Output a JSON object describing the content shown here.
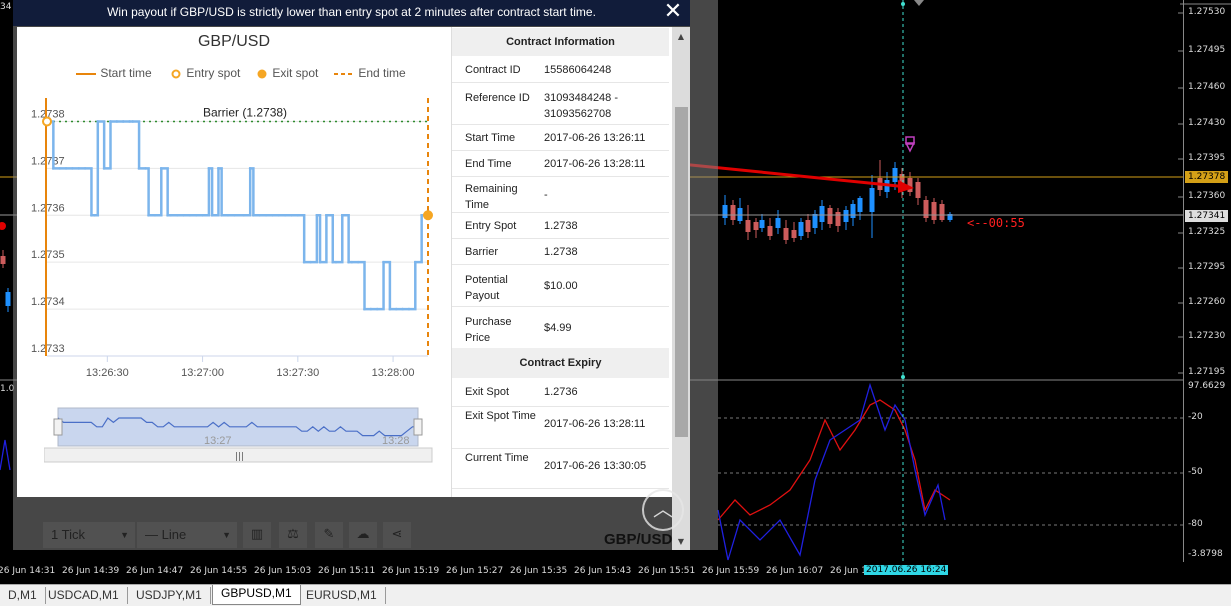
{
  "dialog": {
    "title": "Win payout if GBP/USD is strictly lower than entry spot at 2 minutes after contract start time.",
    "close_label": "✕"
  },
  "mini_chart": {
    "title": "GBP/USD",
    "legend": {
      "start_time": "Start time",
      "entry_spot": "Entry spot",
      "exit_spot": "Exit spot",
      "end_time": "End time"
    },
    "barrier_label": "Barrier (1.2738)",
    "navigator_labels": [
      "13:27",
      "13:28"
    ],
    "colors": {
      "line": "#7cb5ec",
      "start_end": "#e8850c",
      "barrier": "#2e8b2e"
    }
  },
  "chart_data": {
    "type": "line",
    "title": "GBP/USD",
    "xlabel": "",
    "ylabel": "",
    "x_ticks": [
      "13:26:30",
      "13:27:00",
      "13:27:30",
      "13:28:00"
    ],
    "y_ticks": [
      "1.2738",
      "1.2737",
      "1.2736",
      "1.2735",
      "1.2734",
      "1.2733"
    ],
    "ylim": [
      1.2733,
      1.27385
    ],
    "xlim": [
      "13:26:11",
      "13:28:11"
    ],
    "series": [
      {
        "values_x": [
          "13:26:11",
          "13:26:13",
          "13:26:15",
          "13:26:17",
          "13:26:19",
          "13:26:21",
          "13:26:23",
          "13:26:25",
          "13:26:26",
          "13:26:27",
          "13:26:29",
          "13:26:31",
          "13:26:33",
          "13:26:35",
          "13:26:37",
          "13:26:38",
          "13:26:40",
          "13:26:42",
          "13:26:43",
          "13:26:45",
          "13:26:47",
          "13:26:49",
          "13:26:50",
          "13:26:52",
          "13:26:54",
          "13:26:56",
          "13:26:58",
          "13:27:00",
          "13:27:02",
          "13:27:03",
          "13:27:05",
          "13:27:06",
          "13:27:08",
          "13:27:10",
          "13:27:13",
          "13:27:15",
          "13:27:16",
          "13:27:18",
          "13:27:20",
          "13:27:22",
          "13:27:24",
          "13:27:26",
          "13:27:28",
          "13:27:30",
          "13:27:32",
          "13:27:34",
          "13:27:36",
          "13:27:37",
          "13:27:39",
          "13:27:41",
          "13:27:42",
          "13:27:44",
          "13:27:46",
          "13:27:47",
          "13:27:49",
          "13:27:51",
          "13:27:53",
          "13:27:55",
          "13:27:57",
          "13:27:59",
          "13:28:01",
          "13:28:03",
          "13:28:05",
          "13:28:07",
          "13:28:09",
          "13:28:11"
        ],
        "values": [
          1.2738,
          1.2737,
          1.2737,
          1.2737,
          1.2737,
          1.2737,
          1.2737,
          1.2736,
          1.2736,
          1.2738,
          1.2737,
          1.2738,
          1.2738,
          1.2738,
          1.2738,
          1.2738,
          1.2737,
          1.2737,
          1.2736,
          1.2736,
          1.2737,
          1.2736,
          1.2736,
          1.2736,
          1.2736,
          1.2736,
          1.2736,
          1.2736,
          1.2737,
          1.2736,
          1.2737,
          1.2736,
          1.2736,
          1.2736,
          1.2736,
          1.2737,
          1.2736,
          1.2736,
          1.2736,
          1.2736,
          1.2736,
          1.2736,
          1.2736,
          1.2736,
          1.2735,
          1.2735,
          1.2736,
          1.2735,
          1.2736,
          1.2735,
          1.2735,
          1.2736,
          1.2735,
          1.2735,
          1.2735,
          1.2734,
          1.2734,
          1.2734,
          1.2735,
          1.2734,
          1.2734,
          1.2734,
          1.2734,
          1.2735,
          1.2736,
          1.2736
        ]
      }
    ],
    "barrier": 1.2738,
    "entry_spot": 1.2738,
    "exit_spot": 1.2736
  },
  "contract_info": {
    "header": "Contract Information",
    "rows": [
      {
        "label": "Contract ID",
        "value": "15586064248"
      },
      {
        "label": "Reference ID",
        "value": "31093484248 - 31093562708"
      },
      {
        "label": "Start Time",
        "value": "2017-06-26 13:26:11"
      },
      {
        "label": "End Time",
        "value": "2017-06-26 13:28:11"
      },
      {
        "label": "Remaining Time",
        "value": "-"
      },
      {
        "label": "Entry Spot",
        "value": "1.2738"
      },
      {
        "label": "Barrier",
        "value": "1.2738"
      },
      {
        "label": "Potential Payout",
        "value": "$10.00"
      },
      {
        "label": "Purchase Price",
        "value": "$4.99"
      }
    ]
  },
  "contract_expiry": {
    "header": "Contract Expiry",
    "rows": [
      {
        "label": "Exit Spot",
        "value": "1.2736"
      },
      {
        "label": "Exit Spot Time",
        "value": "2017-06-26 13:28:11"
      },
      {
        "label": "Current Time",
        "value": "2017-06-26 13:30:05"
      }
    ]
  },
  "toolbar": {
    "tick_select": "1 Tick",
    "chart_type_select": "— Line",
    "symbol": "GBP/USD",
    "icons": [
      "bar-chart-icon",
      "scale-icon",
      "pencil-icon",
      "cloud-download-icon",
      "share-icon"
    ]
  },
  "mt_chart": {
    "price_labels": [
      "1.27530",
      "1.27495",
      "1.27460",
      "1.27430",
      "1.27395",
      "1.27360",
      "1.27325",
      "1.27295",
      "1.27260",
      "1.27230",
      "1.27195"
    ],
    "current_price": "1.27378",
    "bid_price": "1.27341",
    "countdown": "<--00:55",
    "osc_labels": [
      "97.6629",
      "-20",
      "-50",
      "-80",
      "-3.8798"
    ],
    "time_labels": [
      "26 Jun 14:31",
      "26 Jun 14:39",
      "26 Jun 14:47",
      "26 Jun 14:55",
      "26 Jun 15:03",
      "26 Jun 15:11",
      "26 Jun 15:19",
      "26 Jun 15:27",
      "26 Jun 15:35",
      "26 Jun 15:43",
      "26 Jun 15:51",
      "26 Jun 15:59",
      "26 Jun 16:07",
      "26 Jun 1"
    ],
    "time_highlight": "2017.06.26 16:24",
    "left_labels": {
      "top": "34",
      "osc": "1.0"
    },
    "colors": {
      "bull": "#1e90ff",
      "bear": "#cd5c5c",
      "grid": "#2a2a2a",
      "cursor": "#40e0d0",
      "price_line": "#d4a017"
    }
  },
  "tabs": [
    {
      "label": "D,M1",
      "active": false
    },
    {
      "label": "USDCAD,M1",
      "active": false
    },
    {
      "label": "USDJPY,M1",
      "active": false
    },
    {
      "label": "GBPUSD,M1",
      "active": true
    },
    {
      "label": "EURUSD,M1",
      "active": false
    }
  ]
}
